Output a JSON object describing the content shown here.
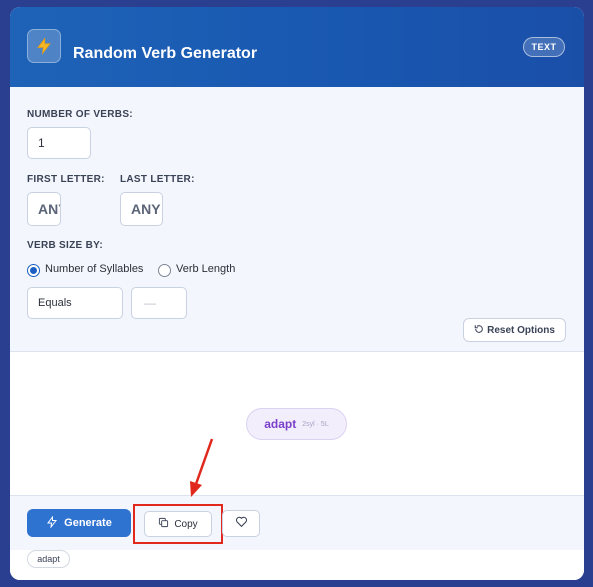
{
  "header": {
    "title": "Random Verb Generator",
    "badge": "TEXT",
    "icon": "lightning-icon"
  },
  "options": {
    "number_label": "NUMBER OF VERBS:",
    "number_value": "1",
    "first_letter_label": "FIRST LETTER:",
    "first_letter_value": "ANY",
    "last_letter_label": "LAST LETTER:",
    "last_letter_value": "ANY",
    "size_label": "VERB SIZE BY:",
    "radio_syllables": "Number of Syllables",
    "radio_length": "Verb Length",
    "selected_size_mode": "Number of Syllables",
    "comparator_value": "Equals",
    "size_value": "—",
    "reset_label": "Reset Options"
  },
  "result": {
    "verb": "adapt",
    "meta": "2syl · 5L"
  },
  "footer": {
    "generate_label": "Generate",
    "copy_label": "Copy",
    "favorite_icon": "heart-icon"
  },
  "history": {
    "items": [
      "adapt"
    ]
  },
  "colors": {
    "accent": "#2f73d1",
    "highlight": "#e0281c",
    "verb": "#7b3fc9"
  }
}
